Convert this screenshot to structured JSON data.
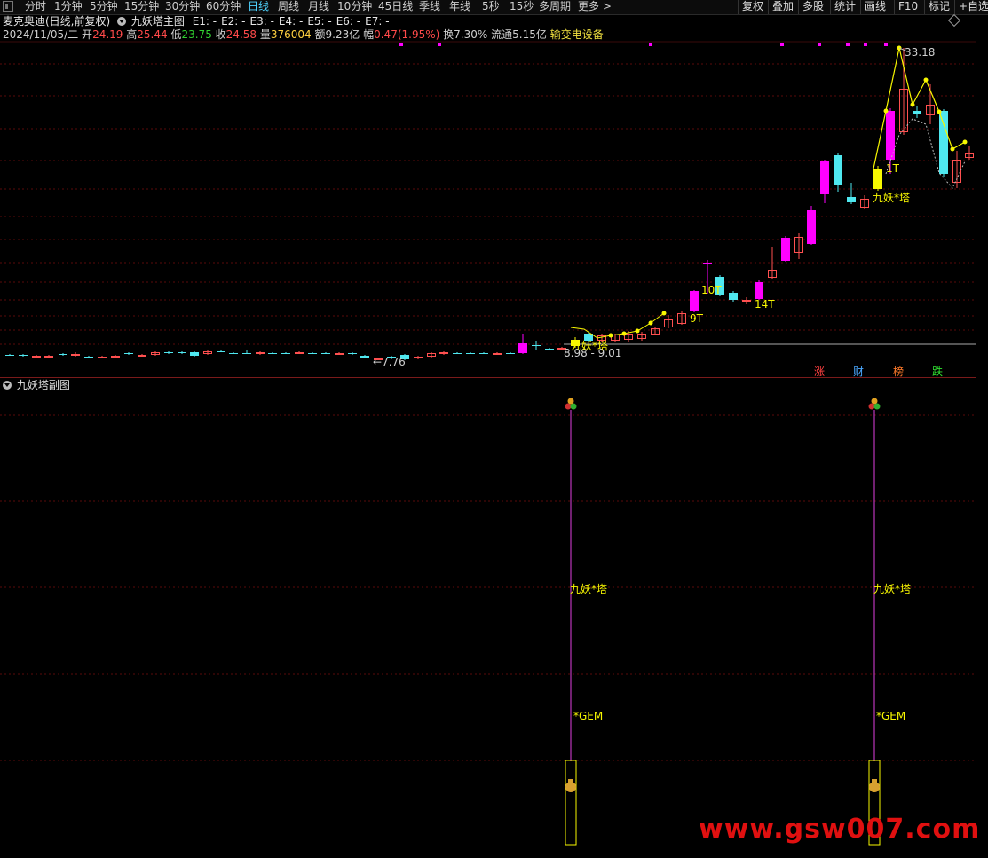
{
  "toolbar": {
    "periods": [
      "分时",
      "1分钟",
      "5分钟",
      "15分钟",
      "30分钟",
      "60分钟",
      "日线",
      "周线",
      "月线",
      "10分钟",
      "45日线",
      "季线",
      "年线",
      "5秒",
      "15秒",
      "多周期",
      "更多 >"
    ],
    "active_period": "日线",
    "right_buttons": [
      "复权",
      "叠加",
      "多股",
      "统计",
      "画线",
      "F10",
      "标记",
      "+自选"
    ]
  },
  "header": {
    "stock_title": "麦克奥迪(日线,前复权)",
    "indicator_name": "九妖塔主图",
    "e_labels": [
      "E1: -",
      "E2: -",
      "E3: -",
      "E4: -",
      "E5: -",
      "E6: -",
      "E7: -"
    ]
  },
  "quote": {
    "date": "2024/11/05/二",
    "open_label": "开",
    "open": "24.19",
    "high_label": "高",
    "high": "25.44",
    "low_label": "低",
    "low": "23.75",
    "close_label": "收",
    "close": "24.58",
    "volume_label": "量",
    "volume": "376004",
    "amount_label": "额",
    "amount": "9.23亿",
    "change_label": "幅",
    "change": "0.47(1.95%)",
    "turnover_label": "换",
    "turnover": "7.30%",
    "float_label": "流通",
    "float": "5.15亿",
    "sector": "输变电设备"
  },
  "main_chart": {
    "high_marker": "33.18",
    "low_marker": "7.76",
    "range_label": "8.98 - 9.01",
    "labels": [
      "10T",
      "9T",
      "14T",
      "1T",
      "九妖*塔",
      "九妖*塔"
    ],
    "bottom_tags": [
      {
        "text": "涨",
        "color": "#ff4040"
      },
      {
        "text": "财",
        "color": "#4aa8ff"
      },
      {
        "text": "榜",
        "color": "#ff7a2a"
      },
      {
        "text": "跌",
        "color": "#30e030"
      }
    ]
  },
  "sub_chart": {
    "title": "九妖塔副图",
    "signal_label": "九妖*塔",
    "gem_label": "*GEM"
  },
  "watermark": "www.gsw007.com",
  "colors": {
    "up_magenta": "#ff00ff",
    "down_cyan": "#4fe8f0",
    "up_hollow": "#ff5050",
    "yellow": "#f8f800",
    "grid": "#5a0a0a"
  }
}
